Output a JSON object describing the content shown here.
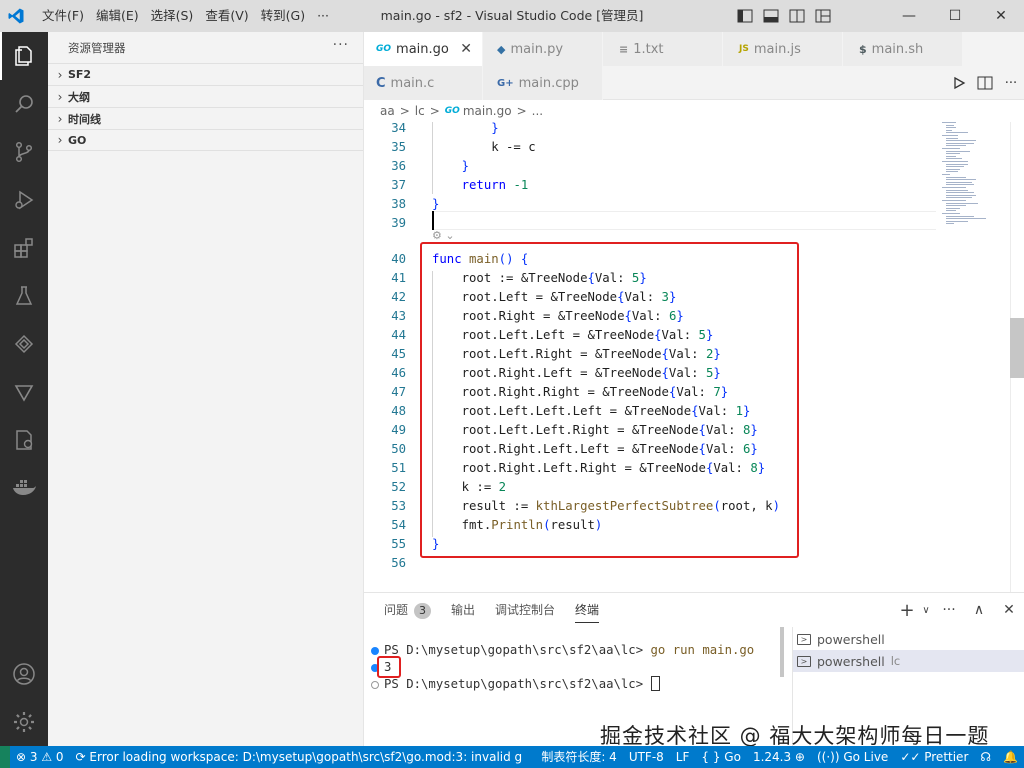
{
  "app": {
    "window_title": "main.go - sf2 - Visual Studio Code [管理员]",
    "menu": [
      "文件(F)",
      "编辑(E)",
      "选择(S)",
      "查看(V)",
      "转到(G)",
      "···"
    ]
  },
  "window_controls": {
    "minimize": "—",
    "maximize": "☐",
    "close": "✕"
  },
  "sidebar": {
    "title": "资源管理器",
    "more": "···",
    "sections": [
      "SF2",
      "大纲",
      "时间线",
      "GO"
    ]
  },
  "tabs_row1": [
    {
      "icon": "GO",
      "label": "main.go",
      "active": true,
      "close": "✕",
      "icon_color": "#00acd7"
    },
    {
      "icon": "◆",
      "label": "main.py",
      "active": false,
      "icon_color": "#3572a5"
    },
    {
      "icon": "≡",
      "label": "1.txt",
      "active": false,
      "icon_color": "#888888"
    },
    {
      "icon": "JS",
      "label": "main.js",
      "active": false,
      "icon_color": "#cbcb41"
    },
    {
      "icon": "$",
      "label": "main.sh",
      "active": false,
      "icon_color": "#4d5a5e"
    }
  ],
  "tabs_row2": [
    {
      "icon": "C",
      "label": "main.c",
      "active": false,
      "icon_color": "#555555"
    },
    {
      "icon": "G+",
      "label": "main.cpp",
      "active": false,
      "icon_color": "#a074c4"
    }
  ],
  "breadcrumb": [
    "aa",
    ">",
    "lc",
    ">",
    "GO",
    "main.go",
    ">",
    "..."
  ],
  "code": {
    "lines": [
      {
        "n": "34",
        "text": "        }"
      },
      {
        "n": "35",
        "text": "        k -= c"
      },
      {
        "n": "36",
        "text": "    }"
      },
      {
        "n": "37",
        "text": "    return -1"
      },
      {
        "n": "38",
        "text": "}"
      },
      {
        "n": "39",
        "text": ""
      },
      {
        "n": "40",
        "text": "func main() {"
      },
      {
        "n": "41",
        "text": "    root := &TreeNode{Val: 5}"
      },
      {
        "n": "42",
        "text": "    root.Left = &TreeNode{Val: 3}"
      },
      {
        "n": "43",
        "text": "    root.Right = &TreeNode{Val: 6}"
      },
      {
        "n": "44",
        "text": "    root.Left.Left = &TreeNode{Val: 5}"
      },
      {
        "n": "45",
        "text": "    root.Left.Right = &TreeNode{Val: 2}"
      },
      {
        "n": "46",
        "text": "    root.Right.Left = &TreeNode{Val: 5}"
      },
      {
        "n": "47",
        "text": "    root.Right.Right = &TreeNode{Val: 7}"
      },
      {
        "n": "48",
        "text": "    root.Left.Left.Left = &TreeNode{Val: 1}"
      },
      {
        "n": "49",
        "text": "    root.Left.Left.Right = &TreeNode{Val: 8}"
      },
      {
        "n": "50",
        "text": "    root.Right.Left.Left = &TreeNode{Val: 6}"
      },
      {
        "n": "51",
        "text": "    root.Right.Left.Right = &TreeNode{Val: 8}"
      },
      {
        "n": "52",
        "text": "    k := 2"
      },
      {
        "n": "53",
        "text": "    result := kthLargestPerfectSubtree(root, k)"
      },
      {
        "n": "54",
        "text": "    fmt.Println(result)"
      },
      {
        "n": "55",
        "text": "}"
      },
      {
        "n": "56",
        "text": ""
      }
    ]
  },
  "panel": {
    "tabs": [
      {
        "label": "问题",
        "badge": "3"
      },
      {
        "label": "输出"
      },
      {
        "label": "调试控制台"
      },
      {
        "label": "终端",
        "active": true
      }
    ],
    "actions": [
      "+",
      "∨",
      "···",
      "∧",
      "✕"
    ],
    "terminal_lines": [
      {
        "prompt": "PS D:\\mysetup\\gopath\\src\\sf2\\aa\\lc> ",
        "cmd": "go run main.go"
      },
      {
        "prompt": "3",
        "cmd": ""
      },
      {
        "prompt": "PS D:\\mysetup\\gopath\\src\\sf2\\aa\\lc> ",
        "cmd": ""
      }
    ],
    "terminals": [
      {
        "label": "powershell",
        "sub": ""
      },
      {
        "label": "powershell",
        "sub": "lc",
        "active": true
      }
    ]
  },
  "watermark": "掘金技术社区 @ 福大大架构师每日一题",
  "statusbar": {
    "left": [
      "⊗ 3 ⚠ 0",
      "⟳ Error loading workspace: D:\\mysetup\\gopath\\src\\sf2\\go.mod:3: invalid g"
    ],
    "right": [
      "制表符长度: 4",
      "UTF-8",
      "LF",
      "{ } Go",
      "1.24.3 ⊕",
      "((·)) Go Live",
      "✓✓ Prettier",
      "☊",
      "🔔"
    ]
  },
  "colors": {
    "activitybar": "#2c2c2c",
    "statusbar": "#007acc",
    "highlight": "#e02020"
  }
}
